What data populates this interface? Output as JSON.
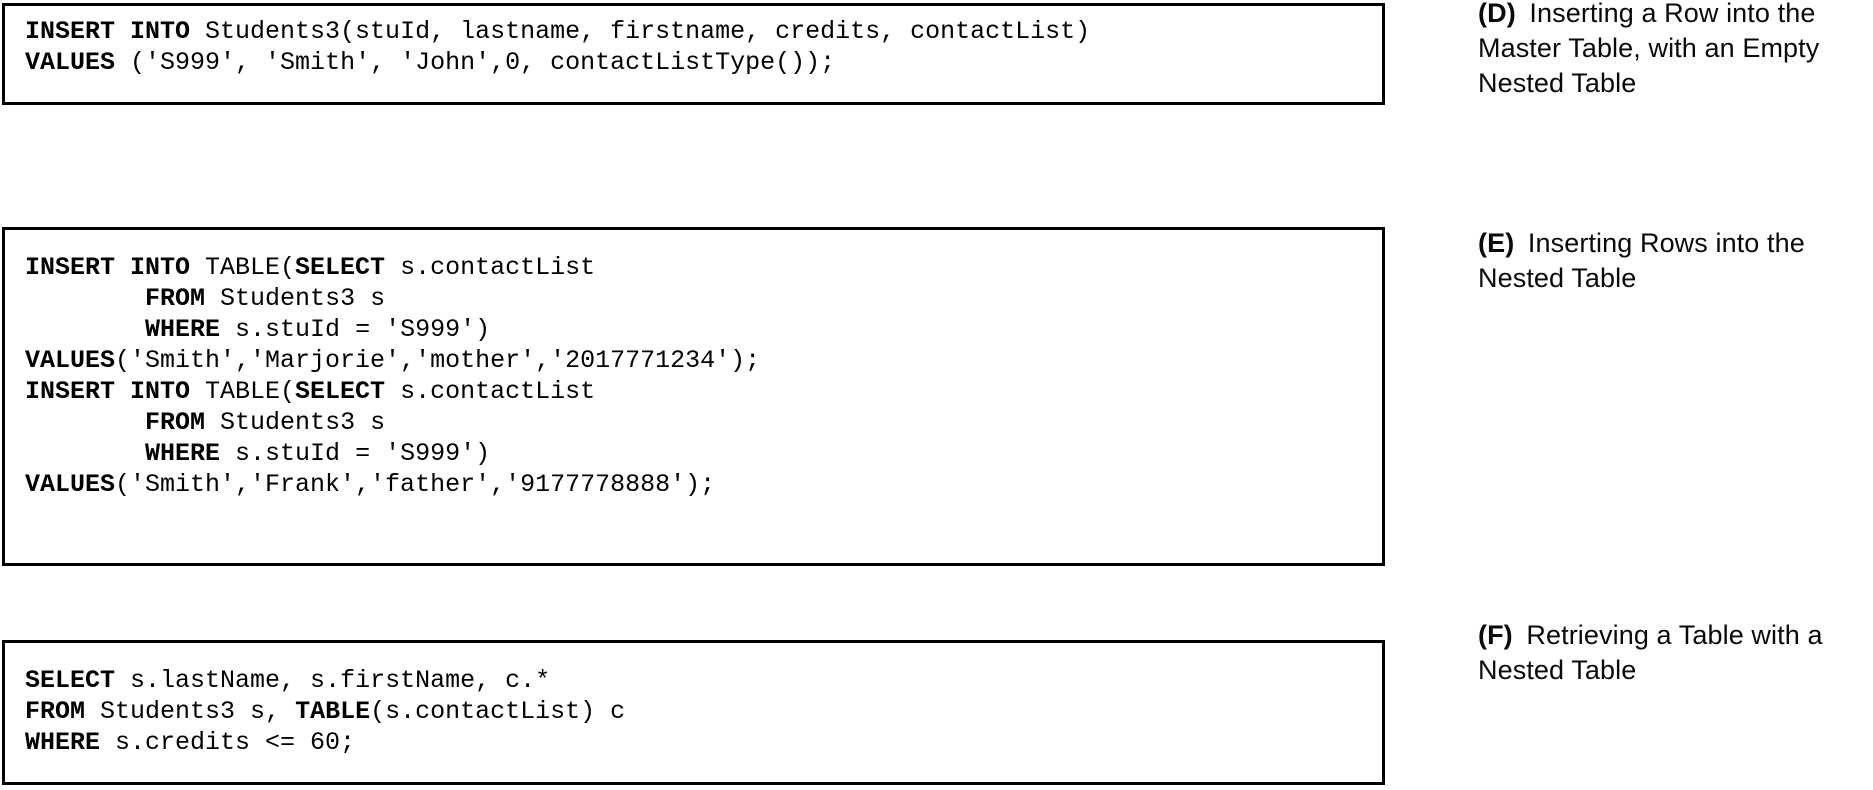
{
  "figure": {
    "background_color": "#ffffff",
    "border_color": "#000000",
    "text_color": "#000000"
  },
  "panels": [
    {
      "id": "D",
      "tag": "(D)",
      "caption": "Inserting a Row into the Master Table, with an Empty Nested Table",
      "code_lines": [
        [
          {
            "t": "INSERT INTO ",
            "b": true
          },
          {
            "t": "Students3(stuId, lastname, firstname, credits, contactList)",
            "b": false
          }
        ],
        [
          {
            "t": "VALUES ",
            "b": true
          },
          {
            "t": "('S999', 'Smith', 'John',0, contactListType());",
            "b": false
          }
        ]
      ],
      "code_text": "INSERT INTO Students3(stuId, lastname, firstname, credits, contactList)\nVALUES ('S999', 'Smith', 'John',0, contactListType());"
    },
    {
      "id": "E",
      "tag": "(E)",
      "caption": "Inserting Rows into the Nested Table",
      "code_lines": [
        [
          {
            "t": "INSERT INTO ",
            "b": true
          },
          {
            "t": "TABLE(",
            "b": false
          },
          {
            "t": "SELECT ",
            "b": true
          },
          {
            "t": "s.contactList",
            "b": false
          }
        ],
        [
          {
            "t": "        FROM ",
            "b": true
          },
          {
            "t": "Students3 s",
            "b": false
          }
        ],
        [
          {
            "t": "        WHERE ",
            "b": true
          },
          {
            "t": "s.stuId = 'S999')",
            "b": false
          }
        ],
        [
          {
            "t": "VALUES",
            "b": true
          },
          {
            "t": "('Smith','Marjorie','mother','2017771234');",
            "b": false
          }
        ],
        [
          {
            "t": "INSERT INTO ",
            "b": true
          },
          {
            "t": "TABLE(",
            "b": false
          },
          {
            "t": "SELECT ",
            "b": true
          },
          {
            "t": "s.contactList",
            "b": false
          }
        ],
        [
          {
            "t": "        FROM ",
            "b": true
          },
          {
            "t": "Students3 s",
            "b": false
          }
        ],
        [
          {
            "t": "        WHERE ",
            "b": true
          },
          {
            "t": "s.stuId = 'S999')",
            "b": false
          }
        ],
        [
          {
            "t": "VALUES",
            "b": true
          },
          {
            "t": "('Smith','Frank','father','9177778888');",
            "b": false
          }
        ]
      ],
      "code_text": "INSERT INTO TABLE(SELECT s.contactList\n        FROM Students3 s\n        WHERE s.stuId = 'S999')\nVALUES('Smith','Marjorie','mother','2017771234');\nINSERT INTO TABLE(SELECT s.contactList\n        FROM Students3 s\n        WHERE s.stuId = 'S999')\nVALUES('Smith','Frank','father','9177778888');"
    },
    {
      "id": "F",
      "tag": "(F)",
      "caption": "Retrieving a Table with a Nested Table",
      "code_lines": [
        [
          {
            "t": "SELECT ",
            "b": true
          },
          {
            "t": "s.lastName, s.firstName, c.*",
            "b": false
          }
        ],
        [
          {
            "t": "FROM ",
            "b": true
          },
          {
            "t": "Students3 s, ",
            "b": false
          },
          {
            "t": "TABLE",
            "b": true
          },
          {
            "t": "(s.contactList) c",
            "b": false
          }
        ],
        [
          {
            "t": "WHERE ",
            "b": true
          },
          {
            "t": "s.credits <= 60;",
            "b": false
          }
        ]
      ],
      "code_text": "SELECT s.lastName, s.firstName, c.*\nFROM Students3 s, TABLE(s.contactList) c\nWHERE s.credits <= 60;"
    }
  ]
}
